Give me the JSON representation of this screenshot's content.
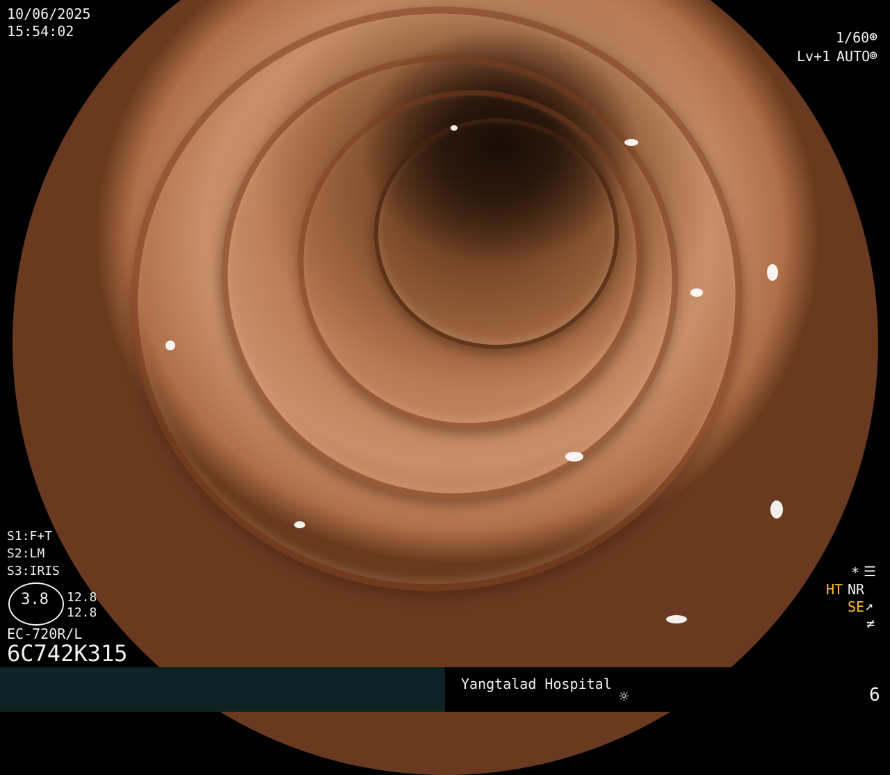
{
  "top_left": {
    "date": "10/06/2025",
    "time": "15:54:02"
  },
  "top_right": {
    "shutter": "1/60",
    "shutter_icon": "shutter-icon",
    "level": "Lv+1",
    "mode": "AUTO",
    "mode_icon": "auto-iris-icon"
  },
  "settings": {
    "s1": "S1:F+T",
    "s2": "S2:LM",
    "s3": "S3:IRIS"
  },
  "scope": {
    "value": "3.8",
    "top_num": "12.8",
    "bottom_num": "12.8",
    "model": "EC-720R/L",
    "serial": "6C742K315"
  },
  "right_panel": {
    "row1_icon": "settings-panel-icon",
    "ht": "HT",
    "nr": "NR",
    "se": "SE",
    "se_icon": "structure-enhance-icon",
    "bottom_icon": "freeze-off-icon"
  },
  "footer": {
    "hospital": "Yangtalad Hospital",
    "light_icon": "light-source-icon",
    "number": "6"
  },
  "colors": {
    "osd_text": "#f2f2f2",
    "highlight": "#ffc020",
    "footer_bg": "#0c2224"
  }
}
